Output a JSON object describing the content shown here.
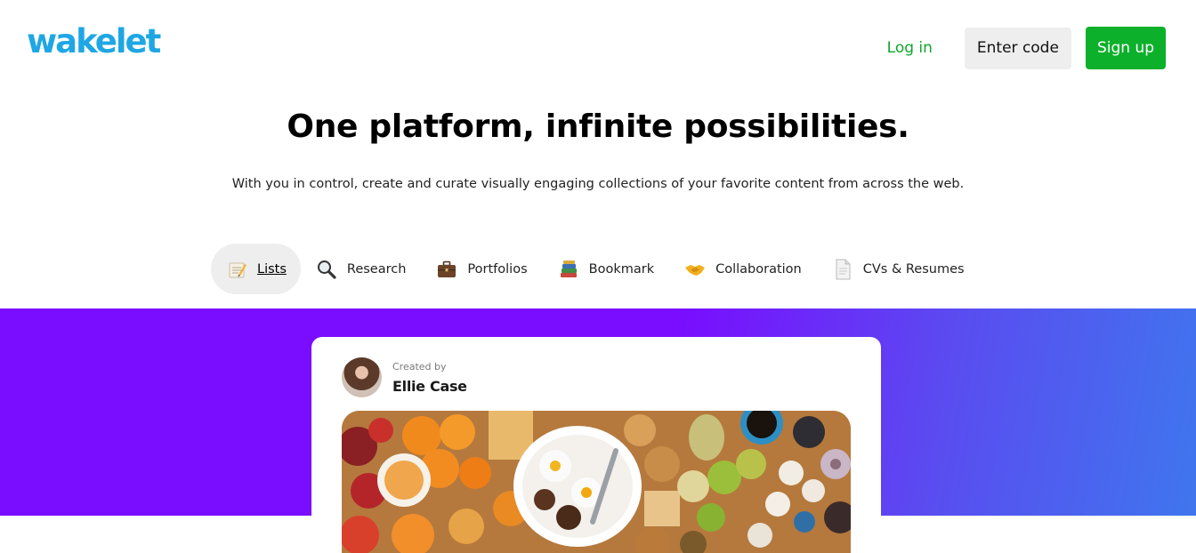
{
  "header": {
    "logo_text": "wakelet",
    "login_label": "Log in",
    "enter_code_label": "Enter code",
    "signup_label": "Sign up"
  },
  "hero": {
    "title": "One platform, infinite possibilities.",
    "subtitle": "With you in control, create and curate visually engaging collections of your favorite content from across the web."
  },
  "tabs": [
    {
      "label": "Lists",
      "icon": "memo-icon",
      "active": true
    },
    {
      "label": "Research",
      "icon": "magnifier-icon",
      "active": false
    },
    {
      "label": "Portfolios",
      "icon": "briefcase-icon",
      "active": false
    },
    {
      "label": "Bookmark",
      "icon": "books-icon",
      "active": false
    },
    {
      "label": "Collaboration",
      "icon": "handshake-icon",
      "active": false
    },
    {
      "label": "CVs & Resumes",
      "icon": "document-icon",
      "active": false
    }
  ],
  "card": {
    "created_by_label": "Created by",
    "creator_name": "Ellie Case"
  },
  "colors": {
    "brand_blue": "#1ea7e4",
    "login_green": "#0fa62b",
    "signup_green": "#0db02b",
    "band_purple": "#7a0cff",
    "band_blue": "#3f76ee"
  }
}
